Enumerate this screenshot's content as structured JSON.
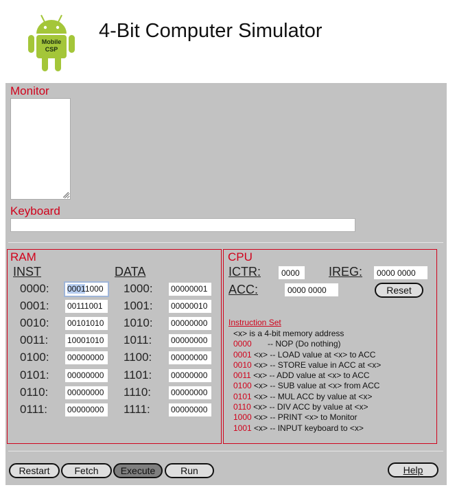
{
  "header": {
    "logo_text_line1": "Mobile",
    "logo_text_line2": "CSP",
    "title": "4-Bit Computer Simulator"
  },
  "colors": {
    "accent_red": "#d0021b",
    "panel_gray": "#c2c2c2",
    "logo_green": "#a4c639"
  },
  "monitor": {
    "label": "Monitor",
    "value": ""
  },
  "keyboard": {
    "label": "Keyboard",
    "value": ""
  },
  "ram": {
    "title": "RAM",
    "inst_header": "INST",
    "data_header": "DATA",
    "inst": [
      {
        "addr": "0000:",
        "value": "00011000",
        "selected_part": "0001",
        "rest": "1000"
      },
      {
        "addr": "0001:",
        "value": "00111001"
      },
      {
        "addr": "0010:",
        "value": "00101010"
      },
      {
        "addr": "0011:",
        "value": "10001010"
      },
      {
        "addr": "0100:",
        "value": "00000000"
      },
      {
        "addr": "0101:",
        "value": "00000000"
      },
      {
        "addr": "0110:",
        "value": "00000000"
      },
      {
        "addr": "0111:",
        "value": "00000000"
      }
    ],
    "data": [
      {
        "addr": "1000:",
        "value": "00000001"
      },
      {
        "addr": "1001:",
        "value": "00000010"
      },
      {
        "addr": "1010:",
        "value": "00000000"
      },
      {
        "addr": "1011:",
        "value": "00000000"
      },
      {
        "addr": "1100:",
        "value": "00000000"
      },
      {
        "addr": "1101:",
        "value": "00000000"
      },
      {
        "addr": "1110:",
        "value": "00000000"
      },
      {
        "addr": "1111:",
        "value": "00000000"
      }
    ]
  },
  "cpu": {
    "title": "CPU",
    "ictr_label": "ICTR:",
    "ictr_value": "0000",
    "ireg_label": "IREG:",
    "ireg_value": "0000 0000",
    "acc_label": "ACC:",
    "acc_value": "0000 0000",
    "reset_label": "Reset"
  },
  "instruction_set": {
    "title": "Instruction Set",
    "note": "<x> is a 4-bit memory address",
    "items": [
      {
        "op": "0000",
        "desc": "       -- NOP (Do nothing)"
      },
      {
        "op": "0001",
        "desc": " <x> -- LOAD value at <x> to ACC"
      },
      {
        "op": "0010",
        "desc": " <x> -- STORE value in ACC at <x>"
      },
      {
        "op": "0011",
        "desc": " <x> -- ADD value at <x> to ACC"
      },
      {
        "op": "0100",
        "desc": " <x> -- SUB value at <x> from ACC"
      },
      {
        "op": "0101",
        "desc": " <x> -- MUL ACC by value at <x>"
      },
      {
        "op": "0110",
        "desc": " <x> -- DIV ACC by value at <x>"
      },
      {
        "op": "1000",
        "desc": " <x> -- PRINT <x> to Monitor"
      },
      {
        "op": "1001",
        "desc": " <x> -- INPUT keyboard to <x>"
      }
    ]
  },
  "controls": {
    "restart": "Restart",
    "fetch": "Fetch",
    "execute": "Execute",
    "run": "Run",
    "help": "Help"
  }
}
